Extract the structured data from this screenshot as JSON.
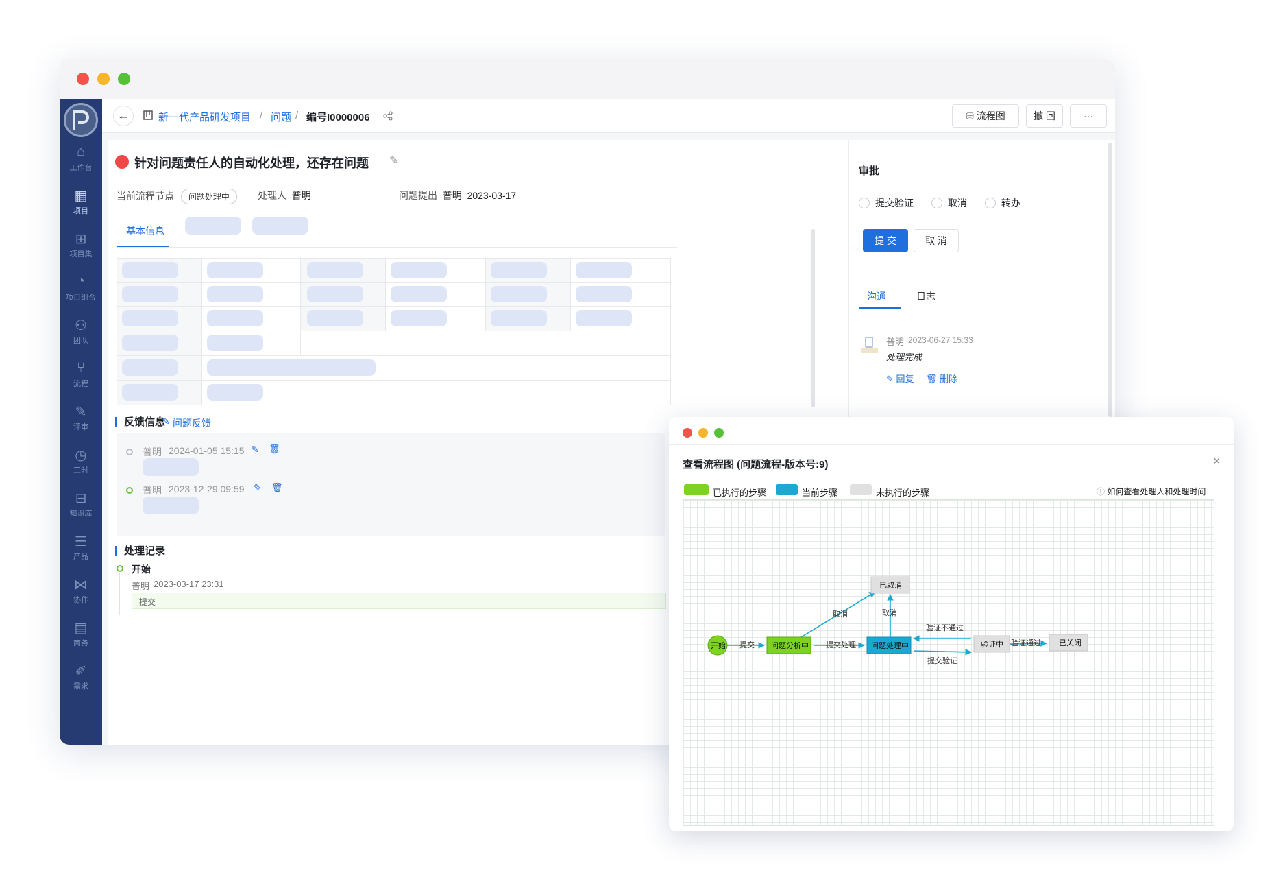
{
  "sidebar": {
    "items": [
      {
        "label": "工作台",
        "icon": "home-icon"
      },
      {
        "label": "项目",
        "icon": "board-icon"
      },
      {
        "label": "项目集",
        "icon": "hierarchy-icon"
      },
      {
        "label": "项目组合",
        "icon": "gauge-icon"
      },
      {
        "label": "团队",
        "icon": "team-icon"
      },
      {
        "label": "流程",
        "icon": "branch-icon"
      },
      {
        "label": "评审",
        "icon": "review-icon"
      },
      {
        "label": "工时",
        "icon": "clock-icon"
      },
      {
        "label": "知识库",
        "icon": "book-icon"
      },
      {
        "label": "产品",
        "icon": "product-icon"
      },
      {
        "label": "协作",
        "icon": "share-icon"
      },
      {
        "label": "商务",
        "icon": "business-icon"
      },
      {
        "label": "需求",
        "icon": "requirement-icon"
      }
    ]
  },
  "breadcrumb": {
    "project": "新一代产品研发项目",
    "sep": "/",
    "module": "问题",
    "current": "编号I0000006"
  },
  "toolbar": {
    "flow_label": "流程图",
    "undo_label": "撤 回",
    "more_label": "···"
  },
  "issue": {
    "title": "针对问题责任人的自动化处理，还存在问题",
    "node_label": "当前流程节点",
    "node_value": "问题处理中",
    "handler_label": "处理人",
    "handler_value": "普明",
    "raised_label": "问题提出",
    "raised_by": "普明",
    "raised_date": "2023-03-17"
  },
  "tabs": {
    "basic": "基本信息"
  },
  "feedback": {
    "title": "反馈信息",
    "link": "问题反馈",
    "entries": [
      {
        "user": "普明",
        "time": "2024-01-05 15:15"
      },
      {
        "user": "普明",
        "time": "2023-12-29 09:59"
      }
    ]
  },
  "records": {
    "title": "处理记录",
    "step": "开始",
    "user": "普明",
    "time": "2023-03-17 23:31",
    "action": "提交"
  },
  "approval": {
    "title": "审批",
    "options": [
      "提交验证",
      "取消",
      "转办"
    ],
    "submit_label": "提 交",
    "cancel_label": "取 消",
    "tab_comm": "沟通",
    "tab_log": "日志",
    "comment": {
      "user": "普明",
      "time": "2023-06-27 15:33",
      "text": "处理完成",
      "reply": "回复",
      "delete": "删除"
    }
  },
  "flow_dialog": {
    "title": "查看流程图 (问题流程-版本号:9)",
    "legend": [
      {
        "label": "已执行的步骤",
        "color": "#7ed321"
      },
      {
        "label": "当前步骤",
        "color": "#1ba9d2"
      },
      {
        "label": "未执行的步骤",
        "color": "#e0e0e0"
      }
    ],
    "help": "如何查看处理人和处理时间",
    "nodes": {
      "start": "开始",
      "analysis": "问题分析中",
      "processing": "问题处理中",
      "cancelled": "已取消",
      "verifying": "验证中",
      "closed": "已关闭"
    },
    "edges": {
      "submit": "提交",
      "submit_process": "提交处理",
      "cancel1": "取消",
      "cancel2": "取消",
      "verify_fail": "验证不通过",
      "submit_verify": "提交验证",
      "verify_pass": "验证通过"
    }
  },
  "colors": {
    "accent": "#1f6fde",
    "sidebar": "#253b72",
    "done": "#7ed321",
    "current": "#1ba9d2",
    "pending": "#e0e0e0"
  }
}
